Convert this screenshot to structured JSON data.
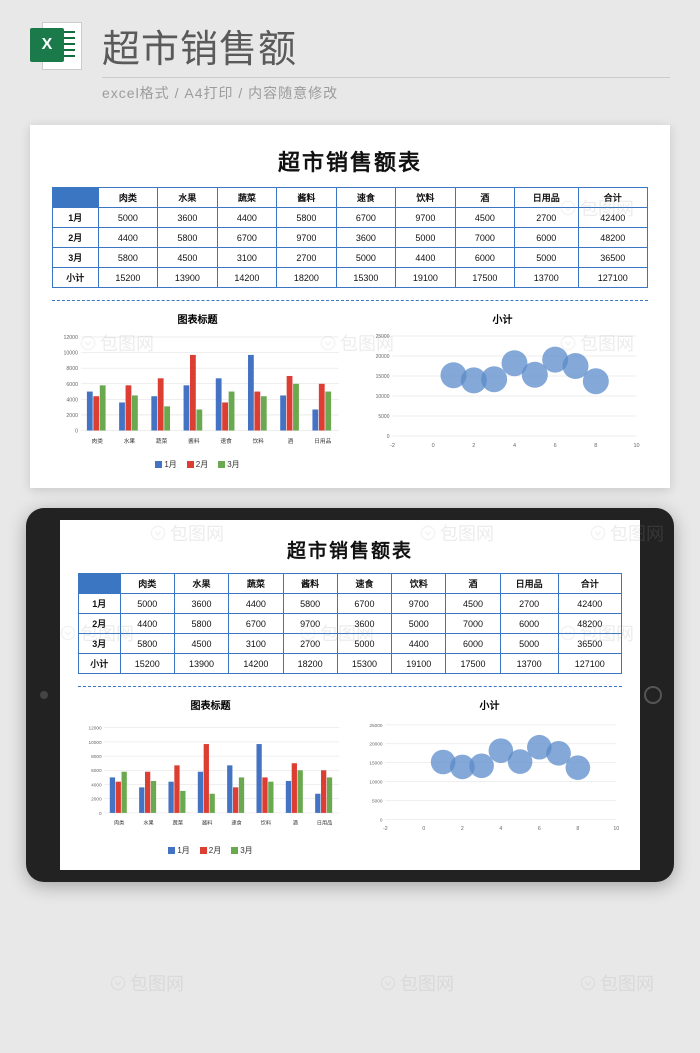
{
  "header": {
    "icon_letter": "X",
    "title": "超市销售额",
    "subtitle": "excel格式 / A4打印 / 内容随意修改"
  },
  "sheet": {
    "title": "超市销售额表",
    "columns": [
      "肉类",
      "水果",
      "蔬菜",
      "酱料",
      "速食",
      "饮料",
      "酒",
      "日用品",
      "合计"
    ],
    "rows": [
      {
        "label": "1月",
        "cells": [
          "5000",
          "3600",
          "4400",
          "5800",
          "6700",
          "9700",
          "4500",
          "2700",
          "42400"
        ]
      },
      {
        "label": "2月",
        "cells": [
          "4400",
          "5800",
          "6700",
          "9700",
          "3600",
          "5000",
          "7000",
          "6000",
          "48200"
        ]
      },
      {
        "label": "3月",
        "cells": [
          "5800",
          "4500",
          "3100",
          "2700",
          "5000",
          "4400",
          "6000",
          "5000",
          "36500"
        ]
      },
      {
        "label": "小计",
        "cells": [
          "15200",
          "13900",
          "14200",
          "18200",
          "15300",
          "19100",
          "17500",
          "13700",
          "127100"
        ]
      }
    ]
  },
  "chart_data": [
    {
      "type": "bar",
      "title": "图表标题",
      "categories": [
        "肉类",
        "水果",
        "蔬菜",
        "酱料",
        "速食",
        "饮料",
        "酒",
        "日用品"
      ],
      "series": [
        {
          "name": "1月",
          "color": "#4573c4",
          "values": [
            5000,
            3600,
            4400,
            5800,
            6700,
            9700,
            4500,
            2700
          ]
        },
        {
          "name": "2月",
          "color": "#dc3e33",
          "values": [
            4400,
            5800,
            6700,
            9700,
            3600,
            5000,
            7000,
            6000
          ]
        },
        {
          "name": "3月",
          "color": "#6aa94f",
          "values": [
            5800,
            4500,
            3100,
            2700,
            5000,
            4400,
            6000,
            5000
          ]
        }
      ],
      "ylim": [
        0,
        12000
      ],
      "yticks": [
        0,
        2000,
        4000,
        6000,
        8000,
        10000,
        12000
      ]
    },
    {
      "type": "bubble",
      "title": "小计",
      "x": [
        1,
        2,
        3,
        4,
        5,
        6,
        7,
        8
      ],
      "y": [
        15200,
        13900,
        14200,
        18200,
        15300,
        19100,
        17500,
        13700
      ],
      "color": "#5b8bc9",
      "xlim": [
        -2,
        10
      ],
      "ylim": [
        0,
        25000
      ],
      "yticks": [
        0,
        5000,
        10000,
        15000,
        20000,
        25000
      ],
      "xticks": [
        -2,
        0,
        2,
        4,
        6,
        8,
        10
      ]
    }
  ],
  "watermark": "包图网"
}
